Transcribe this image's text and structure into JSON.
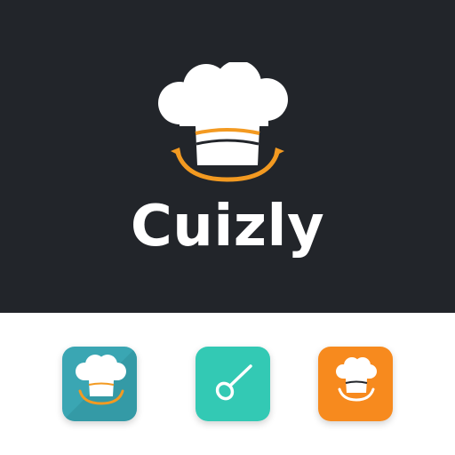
{
  "brand": {
    "name": "Cuizly",
    "logo_icon": "chef-hat-icon"
  },
  "colors": {
    "hero_background": "#22252a",
    "accent_orange": "#f39a21",
    "teal": "#3aa6b3",
    "mint": "#33c9b4",
    "orange": "#f78a1e",
    "white": "#ffffff"
  },
  "app_icons": [
    {
      "icon": "chef-hat-icon",
      "background": "#3aa6b3"
    },
    {
      "icon": "spoon-icon",
      "background": "#33c9b4"
    },
    {
      "icon": "chef-hat-icon",
      "background": "#f78a1e"
    }
  ]
}
